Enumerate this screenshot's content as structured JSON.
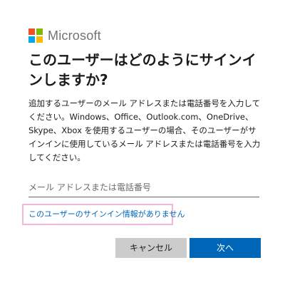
{
  "brand": {
    "name": "Microsoft",
    "logo_colors": [
      "#f25022",
      "#7fba00",
      "#00a4ef",
      "#ffb900"
    ]
  },
  "title": "このユーザーはどのようにサインインしますか?",
  "description": "追加するユーザーのメール アドレスまたは電話番号を入力してください。Windows、Office、Outlook.com、OneDrive、Skype、Xbox を使用するユーザーの場合、そのユーザーがサインインに使用しているメール アドレスまたは電話番号を入力してください。",
  "email_input": {
    "value": "",
    "placeholder": "メール アドレスまたは電話番号"
  },
  "help_link": "このユーザーのサインイン情報がありません",
  "buttons": {
    "cancel": "キャンセル",
    "next": "次へ"
  },
  "colors": {
    "link": "#0067b8",
    "primary_button": "#0067b8",
    "secondary_button": "#cccccc",
    "highlight_frame": "#f2b7d6"
  }
}
